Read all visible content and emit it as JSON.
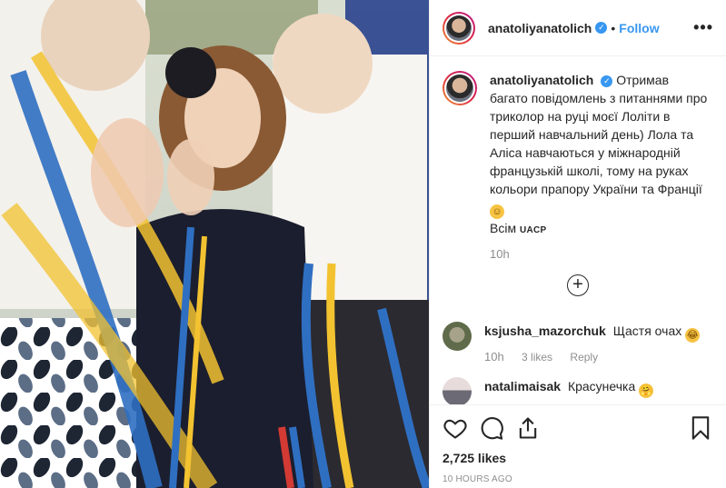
{
  "post": {
    "username": "anatoliyanatolich",
    "follow_label": "Follow",
    "dot": "•",
    "more_label": "•••",
    "verified_mark": "✓"
  },
  "caption": {
    "username": "anatoliyanatolich",
    "text": "Отримав багато повідомлень з питаннями про триколор на руці моєї Лоліти в перший навчальний день) Лола та Аліса навчаються у міжнародній французькій школі, тому на руках кольори прапору України та Франції",
    "emoji": "smiling-face",
    "line2_prefix": "Всім",
    "line2_tag": "UACP",
    "time": "10h"
  },
  "load_more_icon": "plus-circle-icon",
  "comments": [
    {
      "username": "ksjusha_mazorchuk",
      "text": "Щастя очах",
      "emoji": "laughing-face",
      "time": "10h",
      "likes": "3 likes",
      "reply": "Reply"
    },
    {
      "username": "natalimaisak",
      "text": "Красунечка",
      "emoji": "hands-face",
      "time": "",
      "likes": "",
      "reply": ""
    }
  ],
  "footer": {
    "likes": "2,725 likes",
    "time_ago": "10 HOURS AGO",
    "icons": [
      "heart-icon",
      "comment-icon",
      "share-icon",
      "bookmark-icon"
    ]
  },
  "colors": {
    "accent": "#3897f0",
    "ribbon_blue": "#2f6fc2",
    "ribbon_yellow": "#f2c230",
    "ribbon_red": "#d23a33"
  }
}
